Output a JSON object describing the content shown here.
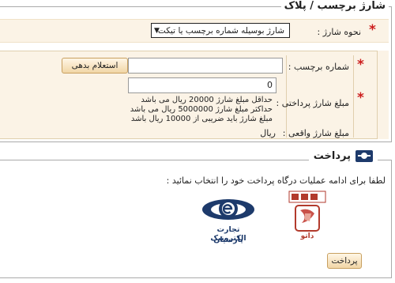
{
  "section1": {
    "title": "شارژ برچسب / پلاک",
    "method_label": "نحوه شارژ :",
    "method_selected": "شارژ بوسیله شماره برچسب یا تیکت",
    "tag_label": "شماره برچسب :",
    "tag_value": "",
    "inquiry_button": "استعلام بدهی",
    "amount_label": "مبلغ شارژ پرداختی :",
    "amount_value": "0",
    "hint1": "حداقل مبلغ شارژ 20000 ریال می باشد",
    "hint2": "حداکثر مبلغ شارژ 5000000 ریال می باشد",
    "hint3": "مبلغ شارژ باید ضریبی از 10000 ریال باشد",
    "actual_label": "مبلغ شارژ واقعی :",
    "actual_unit": "ریال"
  },
  "section2": {
    "title": "پرداخت",
    "instruction": "لطفا برای ادامه عملیات درگاه پرداخت خود را انتخاب نمائید :",
    "gateway1_caption1": "تجارت الکترونیک",
    "gateway1_caption2": "پارسیان",
    "gateway2_caption": "داتو",
    "pay_button": "پرداخت"
  },
  "colors": {
    "panel_bg": "#fbf3e6",
    "star": "#cc1c1c",
    "parsian_blue": "#1d3a6b",
    "logo_red": "#b23a2c"
  }
}
